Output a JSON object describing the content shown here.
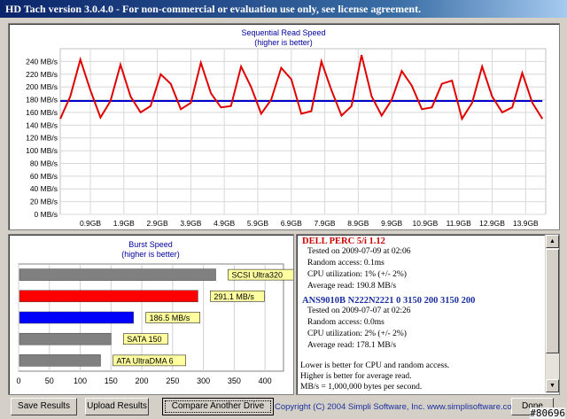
{
  "window": {
    "title": "HD Tach version 3.0.4.0  -  For non-commercial or evaluation use only, see license agreement."
  },
  "seq_chart": {
    "title": "Sequential Read Speed",
    "subtitle": "(higher is better)",
    "y_ticks": [
      "0 MB/s",
      "20 MB/s",
      "40 MB/s",
      "60 MB/s",
      "80 MB/s",
      "100 MB/s",
      "120 MB/s",
      "140 MB/s",
      "160 MB/s",
      "180 MB/s",
      "200 MB/s",
      "220 MB/s",
      "240 MB/s"
    ],
    "x_ticks": [
      "0.9GB",
      "1.9GB",
      "2.9GB",
      "3.9GB",
      "4.9GB",
      "5.9GB",
      "6.9GB",
      "7.9GB",
      "8.9GB",
      "9.9GB",
      "10.9GB",
      "11.9GB",
      "12.9GB",
      "13.9GB"
    ]
  },
  "burst_chart": {
    "title": "Burst Speed",
    "subtitle": "(higher is better)",
    "x_ticks": [
      "0",
      "50",
      "100",
      "150",
      "200",
      "250",
      "300",
      "350",
      "400"
    ]
  },
  "chart_data": [
    {
      "type": "line",
      "title": "Sequential Read Speed",
      "subtitle": "(higher is better)",
      "ylim": [
        0,
        260
      ],
      "x_range_gb": [
        0,
        14.5
      ],
      "x": [
        0.0,
        0.3,
        0.6,
        0.9,
        1.2,
        1.5,
        1.8,
        2.1,
        2.4,
        2.7,
        3.0,
        3.3,
        3.6,
        3.9,
        4.2,
        4.5,
        4.8,
        5.1,
        5.4,
        5.7,
        6.0,
        6.3,
        6.6,
        6.9,
        7.2,
        7.5,
        7.8,
        8.1,
        8.4,
        8.7,
        9.0,
        9.3,
        9.6,
        9.9,
        10.2,
        10.5,
        10.8,
        11.1,
        11.4,
        11.7,
        12.0,
        12.3,
        12.6,
        12.9,
        13.2,
        13.5,
        13.8,
        14.1,
        14.4
      ],
      "series": [
        {
          "color": "#e00000",
          "values": [
            150,
            185,
            243,
            195,
            152,
            178,
            235,
            185,
            160,
            170,
            220,
            205,
            165,
            175,
            238,
            190,
            168,
            170,
            232,
            200,
            158,
            180,
            230,
            212,
            158,
            162,
            240,
            195,
            155,
            170,
            250,
            185,
            155,
            180,
            225,
            202,
            165,
            168,
            205,
            210,
            150,
            175,
            232,
            185,
            160,
            168,
            222,
            175,
            150
          ]
        },
        {
          "color": "#0000cc",
          "values": [
            178,
            178,
            178,
            178,
            178,
            178,
            178,
            178,
            178,
            178,
            178,
            178,
            178,
            178,
            178,
            178,
            178,
            178,
            178,
            178,
            178,
            178,
            178,
            178,
            178,
            178,
            178,
            178,
            178,
            178,
            178,
            178,
            178,
            178,
            178,
            178,
            178,
            178,
            178,
            178,
            178,
            178,
            178,
            178,
            178,
            178,
            178,
            178,
            178
          ]
        }
      ]
    },
    {
      "type": "bar",
      "title": "Burst Speed",
      "subtitle": "(higher is better)",
      "xlim": [
        0,
        430
      ],
      "categories": [
        "SCSI Ultra320",
        "291.1 MB/s",
        "186.5 MB/s",
        "SATA 150",
        "ATA UltraDMA 6"
      ],
      "values": [
        320,
        291.1,
        186.5,
        150,
        133
      ],
      "colors": [
        "#808080",
        "#ff0000",
        "#0000ff",
        "#808080",
        "#808080"
      ]
    }
  ],
  "info": {
    "drives": [
      {
        "name": "DELL PERC 5/i 1.12",
        "color": "#cc0000",
        "lines": [
          "Tested on 2009-07-09 at 02:06",
          "Random access: 0.1ms",
          "CPU utilization: 1% (+/- 2%)",
          "Average read: 190.8 MB/s"
        ]
      },
      {
        "name": "ANS9010B N222N2221 0 3150 200 3150 200",
        "color": "#1a2fa0",
        "lines": [
          "Tested on 2009-07-07 at 02:26",
          "Random access: 0.0ms",
          "CPU utilization: 2% (+/- 2%)",
          "Average read: 178.1 MB/s"
        ]
      }
    ],
    "notes": [
      "Lower is better for CPU and random access.",
      "Higher is better for average read.",
      "MB/s = 1,000,000 bytes per second."
    ]
  },
  "buttons": {
    "save": "Save Results",
    "upload": "Upload Results",
    "compare": "Compare Another Drive",
    "done": "Done"
  },
  "footer": {
    "copyright": "Copyright (C) 2004 Simpli Software, Inc. www.simplisoftware.com",
    "watermark": "#80696"
  }
}
